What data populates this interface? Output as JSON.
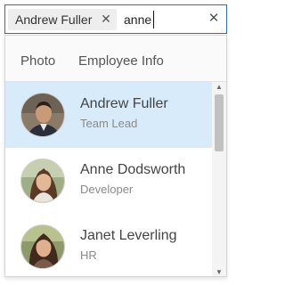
{
  "input": {
    "chip_label": "Andrew Fuller",
    "chip_close_glyph": "✕",
    "typed_text": "anne",
    "clear_glyph": "✕"
  },
  "popup": {
    "header": {
      "photo": "Photo",
      "info": "Employee Info"
    },
    "items": [
      {
        "name": "Andrew Fuller",
        "role": "Team Lead",
        "selected": true
      },
      {
        "name": "Anne Dodsworth",
        "role": "Developer",
        "selected": false
      },
      {
        "name": "Janet Leverling",
        "role": "HR",
        "selected": false
      }
    ],
    "scroll_up_glyph": "▲",
    "scroll_down_glyph": "▼"
  },
  "colors": {
    "focus_border": "#2f6fb0",
    "selected_row": "#d7ebfb",
    "chip_bg": "#eeeeee"
  }
}
